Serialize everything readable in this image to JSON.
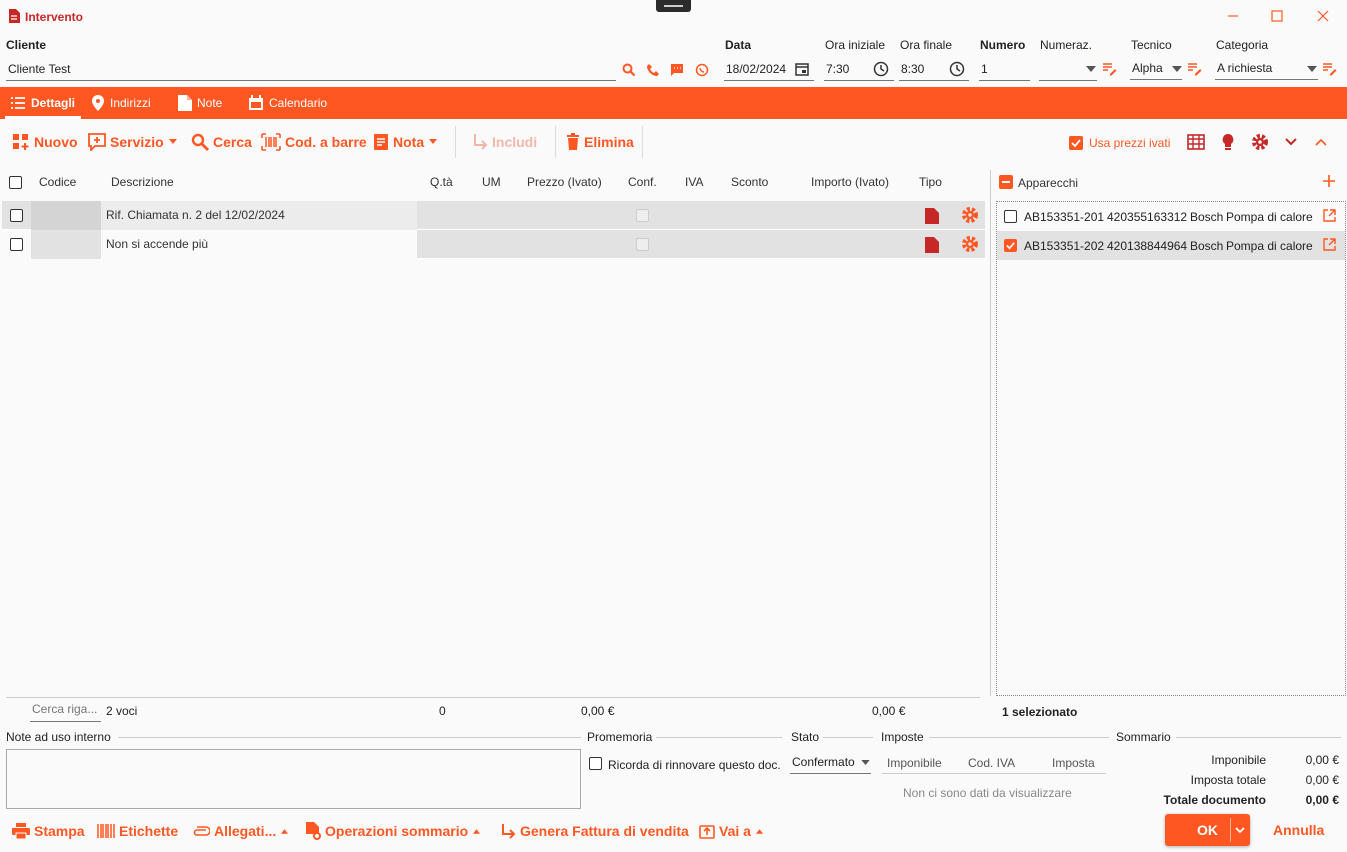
{
  "window": {
    "title": "Intervento",
    "icon": "document-icon"
  },
  "header": {
    "cliente_label": "Cliente",
    "cliente_value": "Cliente Test",
    "data_label": "Data",
    "data_value": "18/02/2024",
    "ora_iniziale_label": "Ora iniziale",
    "ora_iniziale_value": "7:30",
    "ora_finale_label": "Ora finale",
    "ora_finale_value": "8:30",
    "numero_label": "Numero",
    "numero_value": "1",
    "numeraz_label": "Numeraz.",
    "numeraz_value": "",
    "tecnico_label": "Tecnico",
    "tecnico_value": "Alpha",
    "categoria_label": "Categoria",
    "categoria_value": "A richiesta"
  },
  "tabs": [
    {
      "label": "Dettagli",
      "icon": "list-icon",
      "active": true
    },
    {
      "label": "Indirizzi",
      "icon": "location-pin-icon"
    },
    {
      "label": "Note",
      "icon": "note-icon"
    },
    {
      "label": "Calendario",
      "icon": "calendar-icon"
    }
  ],
  "toolbar": {
    "nuovo": "Nuovo",
    "servizio": "Servizio",
    "cerca": "Cerca",
    "codbarre": "Cod. a barre",
    "nota": "Nota",
    "includi": "Includi",
    "elimina": "Elimina",
    "usa_prezzi_ivati": "Usa prezzi ivati"
  },
  "table": {
    "columns": [
      "Codice",
      "Descrizione",
      "Q.tà",
      "UM",
      "Prezzo (Ivato)",
      "Conf.",
      "IVA",
      "Sconto",
      "Importo (Ivato)",
      "Tipo"
    ],
    "rows": [
      {
        "descrizione": "Rif. Chiamata n. 2 del 12/02/2024"
      },
      {
        "descrizione": "Non si accende più"
      }
    ],
    "footer": {
      "search_placeholder": "Cerca riga...",
      "count": "2 voci",
      "qta_total": "0",
      "prezzo_total": "0,00 €",
      "importo_total": "0,00 €"
    }
  },
  "apparecchi": {
    "title": "Apparecchi",
    "items": [
      {
        "code": "AB153351-201",
        "serial": "420355163312",
        "brand": "Bosch",
        "type": "Pompa di calore",
        "checked": false
      },
      {
        "code": "AB153351-202",
        "serial": "420138844964",
        "brand": "Bosch",
        "type": "Pompa di calore",
        "checked": true
      }
    ],
    "selected_count": "1 selezionato"
  },
  "bottom": {
    "note_label": "Note ad uso interno",
    "promemoria_label": "Promemoria",
    "ricorda_label": "Ricorda di rinnovare questo doc.",
    "stato_label": "Stato",
    "stato_value": "Confermato",
    "imposte_label": "Imposte",
    "imposte_cols": [
      "Imponibile",
      "Cod. IVA",
      "Imposta"
    ],
    "imposte_empty": "Non ci sono dati da visualizzare",
    "sommario_label": "Sommario",
    "imponibile_label": "Imponibile",
    "imponibile_value": "0,00 €",
    "imposta_totale_label": "Imposta totale",
    "imposta_totale_value": "0,00 €",
    "totale_label": "Totale documento",
    "totale_value": "0,00 €"
  },
  "actions": {
    "stampa": "Stampa",
    "etichette": "Etichette",
    "allegati": "Allegati...",
    "operazioni": "Operazioni sommario",
    "genera": "Genera Fattura di vendita",
    "vai": "Vai a",
    "ok": "OK",
    "annulla": "Annulla"
  },
  "colors": {
    "accent": "#ff5722",
    "title": "#c62828"
  }
}
